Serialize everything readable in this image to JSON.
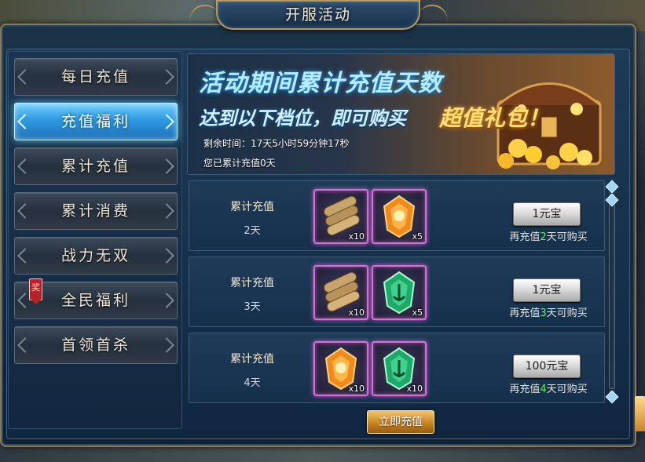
{
  "window": {
    "title": "开服活动"
  },
  "sidebar": {
    "tabs": [
      {
        "label": "每日充值",
        "active": false
      },
      {
        "label": "充值福利",
        "active": true
      },
      {
        "label": "累计充值",
        "active": false
      },
      {
        "label": "累计消费",
        "active": false
      },
      {
        "label": "战力无双",
        "active": false
      },
      {
        "label": "全民福利",
        "active": false,
        "badge": "奖"
      },
      {
        "label": "首领首杀",
        "active": false
      }
    ]
  },
  "banner": {
    "title": "活动期间累计充值天数",
    "subtitle": "达到以下档位，即可购买",
    "highlight": "超值礼包！",
    "remaining_time": "剩余时间：17天5小时59分钟17秒",
    "accumulated": "您已累计充值0天"
  },
  "rewards": [
    {
      "req_label": "累计充值",
      "days": "2天",
      "items": [
        {
          "icon": "scroll-bundle-icon",
          "qty": "x10"
        },
        {
          "icon": "orange-gem-icon",
          "qty": "x5"
        }
      ],
      "price": "1元宝",
      "need_prefix": "再充值",
      "need_num": "2",
      "need_suffix": "天可购买"
    },
    {
      "req_label": "累计充值",
      "days": "3天",
      "items": [
        {
          "icon": "scroll-bundle-icon",
          "qty": "x10"
        },
        {
          "icon": "green-gem-icon",
          "qty": "x5"
        }
      ],
      "price": "1元宝",
      "need_prefix": "再充值",
      "need_num": "3",
      "need_suffix": "天可购买"
    },
    {
      "req_label": "累计充值",
      "days": "4天",
      "items": [
        {
          "icon": "orange-gem-icon",
          "qty": "x10"
        },
        {
          "icon": "green-gem-icon",
          "qty": "x10"
        }
      ],
      "price": "100元宝",
      "need_prefix": "再充值",
      "need_num": "4",
      "need_suffix": "天可购买"
    }
  ],
  "footer": {
    "recharge_label": "立即充值"
  },
  "colors": {
    "active_tab": "#2f9ae3",
    "item_border": "#d86dd6",
    "need_num": "#4bff3a",
    "recharge_button": "#c78424"
  }
}
